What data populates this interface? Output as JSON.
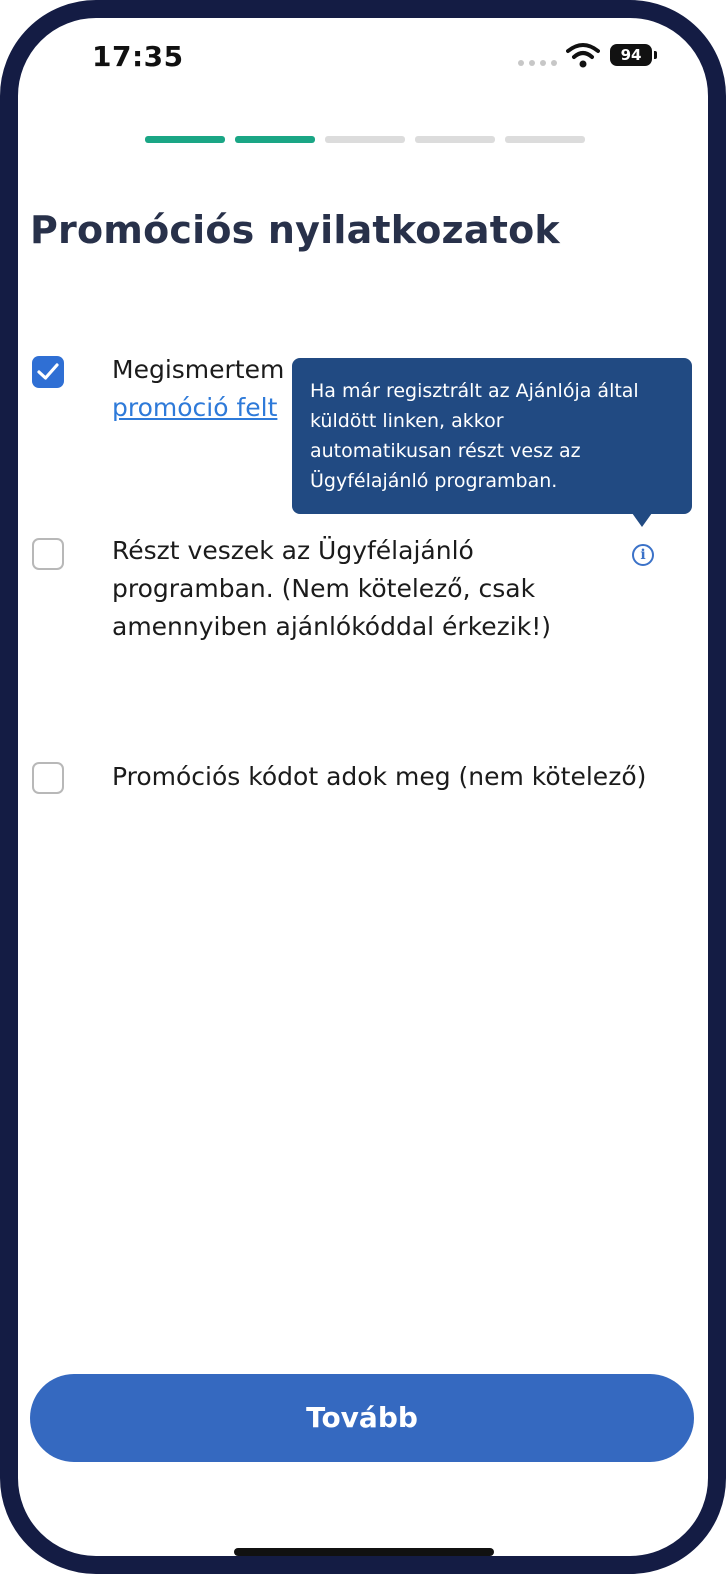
{
  "status_bar": {
    "time": "17:35",
    "battery": "94"
  },
  "progress": {
    "total_steps": 5,
    "completed_steps": 2
  },
  "page": {
    "title": "Promóciós nyilatkozatok"
  },
  "items": [
    {
      "line1": "Megismertem",
      "link": "promóció felt",
      "checked": true
    },
    {
      "line1": "Részt veszek az Ügyfélajánló",
      "line2": "programban. (Nem kötelező, csak",
      "line3": "amennyiben ajánlókóddal érkezik!)",
      "checked": false
    },
    {
      "line1": "Promóciós kódot adok meg (nem kötelező)",
      "checked": false
    }
  ],
  "tooltip": {
    "line1": "Ha már regisztrált az Ajánlója által",
    "line2": "küldött linken, akkor",
    "line3": "automatikusan részt vesz az",
    "line4": "Ügyfélajánló programban."
  },
  "cta": {
    "label": "Tovább"
  },
  "colors": {
    "frame": "#141c44",
    "accent": "#3569c0",
    "progress_done": "#1aa685",
    "link": "#2e7ad9",
    "tooltip_bg": "#214a82"
  }
}
